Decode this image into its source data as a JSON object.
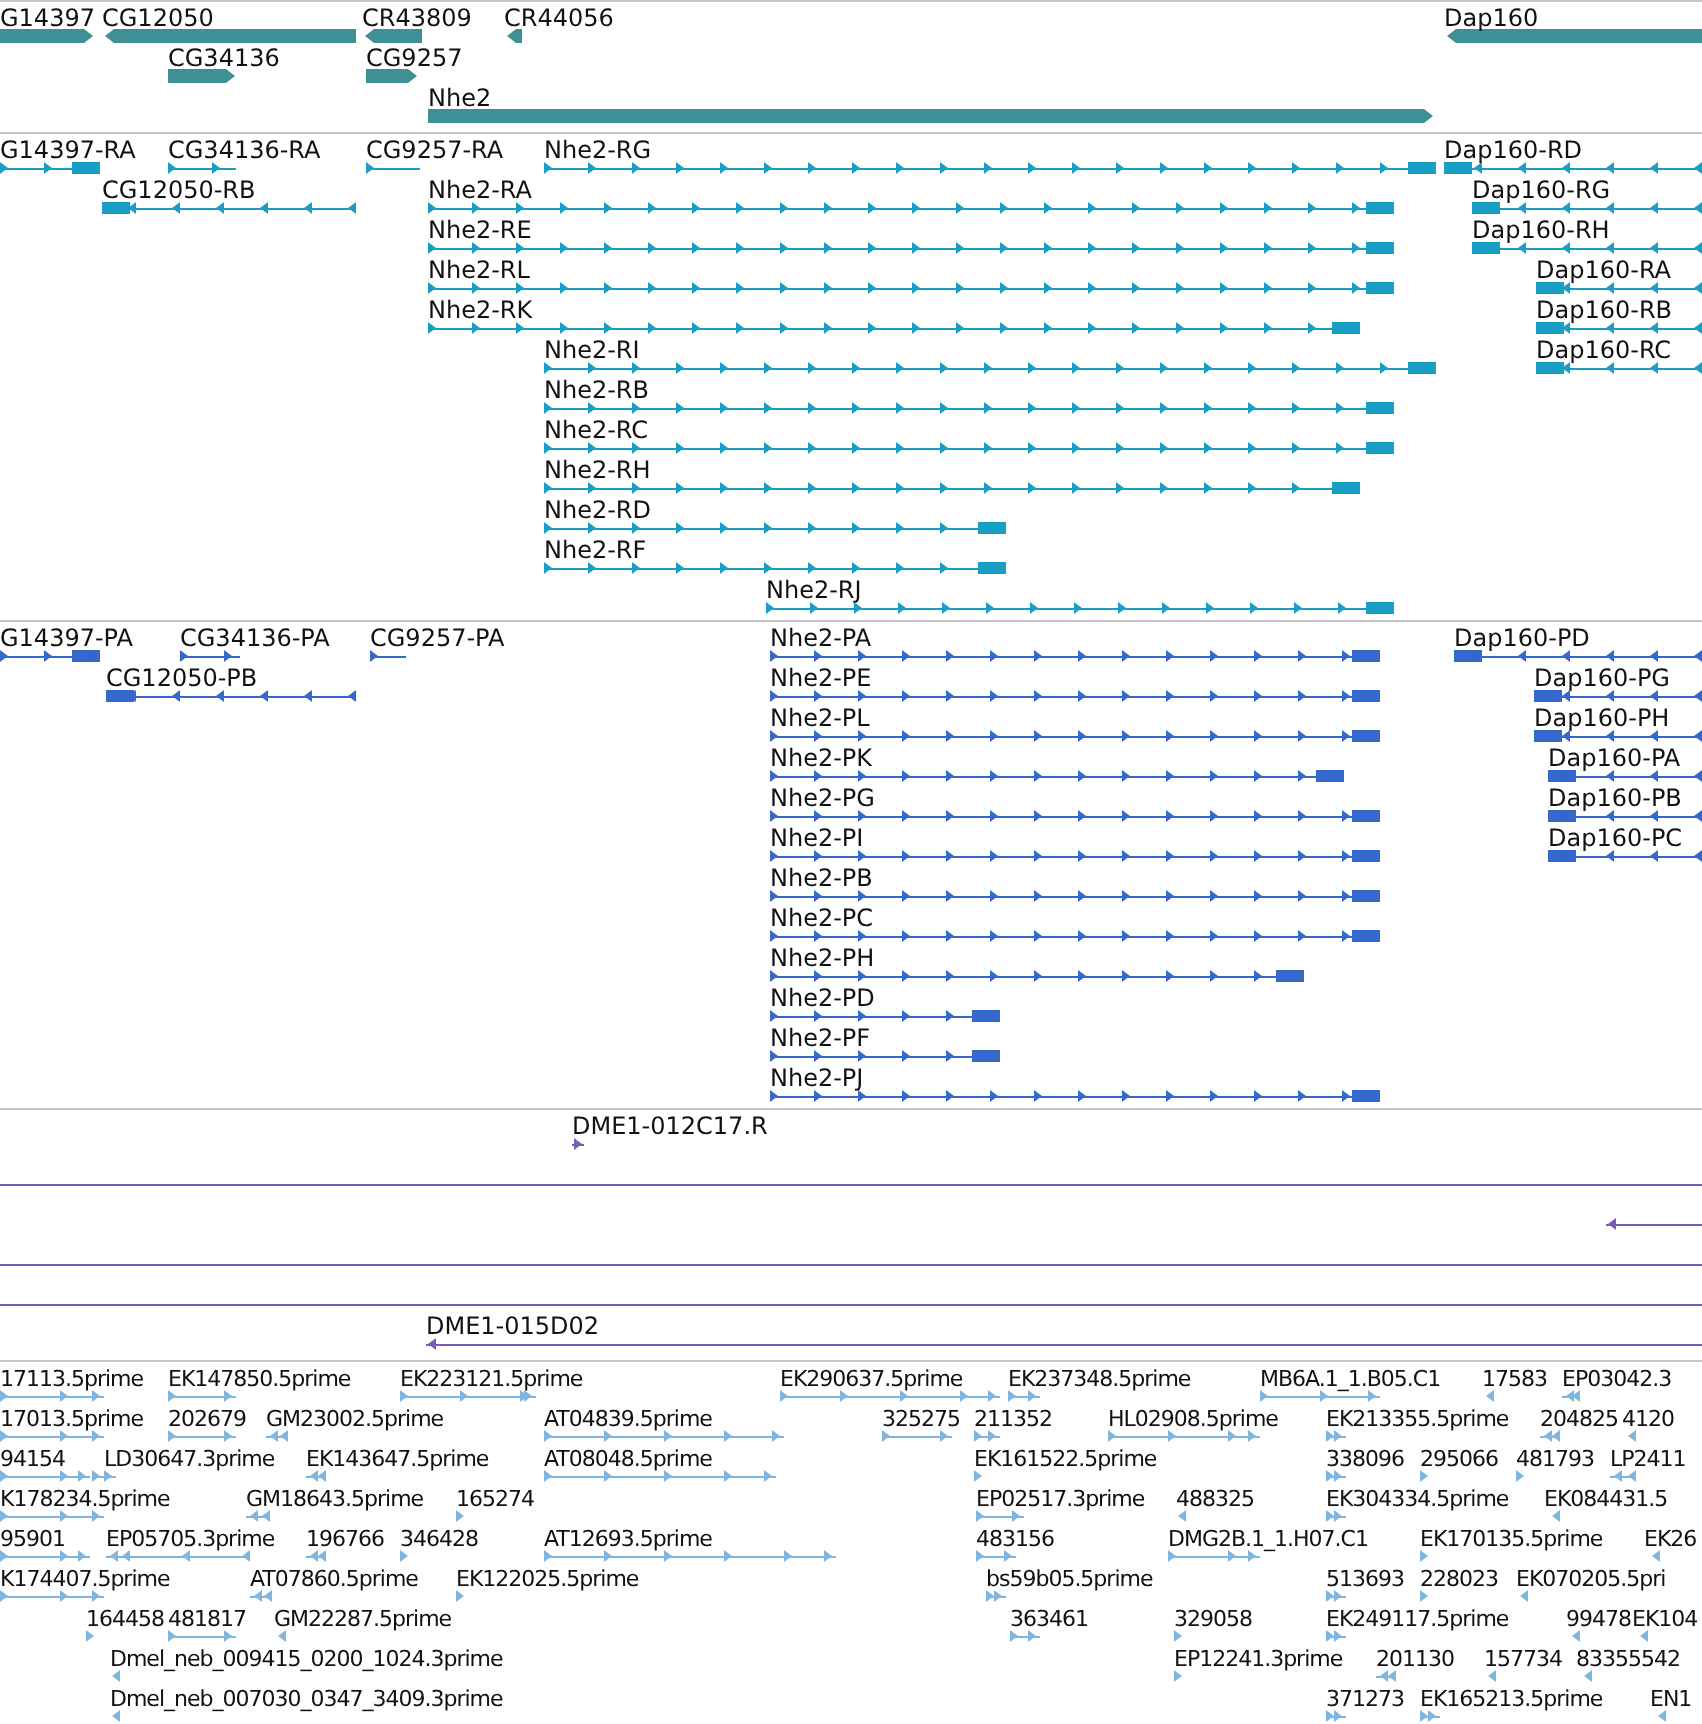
{
  "tracks": [
    {
      "kind": "gene",
      "features": [
        {
          "label": "G14397",
          "reverse": false
        },
        {
          "label": "CG12050",
          "reverse": true
        },
        {
          "label": "CR43809",
          "reverse": true
        },
        {
          "label": "CR44056",
          "reverse": true
        },
        {
          "label": "Dap160",
          "reverse": true
        },
        {
          "label": "CG34136",
          "reverse": false
        },
        {
          "label": "CG9257",
          "reverse": false
        },
        {
          "label": "Nhe2",
          "reverse": false
        }
      ]
    },
    {
      "kind": "transcript",
      "features": [
        {
          "label": "G14397-RA",
          "reverse": false
        },
        {
          "label": "CG34136-RA",
          "reverse": false
        },
        {
          "label": "CG9257-RA",
          "reverse": false
        },
        {
          "label": "Nhe2-RG",
          "reverse": false
        },
        {
          "label": "Dap160-RD",
          "reverse": true
        },
        {
          "label": "CG12050-RB",
          "reverse": true
        },
        {
          "label": "Nhe2-RA",
          "reverse": false
        },
        {
          "label": "Dap160-RG",
          "reverse": true
        },
        {
          "label": "Nhe2-RE",
          "reverse": false
        },
        {
          "label": "Dap160-RH",
          "reverse": true
        },
        {
          "label": "Nhe2-RL",
          "reverse": false
        },
        {
          "label": "Dap160-RA",
          "reverse": true
        },
        {
          "label": "Nhe2-RK",
          "reverse": false
        },
        {
          "label": "Dap160-RB",
          "reverse": true
        },
        {
          "label": "Nhe2-RI",
          "reverse": false
        },
        {
          "label": "Dap160-RC",
          "reverse": true
        },
        {
          "label": "Nhe2-RB",
          "reverse": false
        },
        {
          "label": "Nhe2-RC",
          "reverse": false
        },
        {
          "label": "Nhe2-RH",
          "reverse": false
        },
        {
          "label": "Nhe2-RD",
          "reverse": false
        },
        {
          "label": "Nhe2-RF",
          "reverse": false
        },
        {
          "label": "Nhe2-RJ",
          "reverse": false
        }
      ]
    },
    {
      "kind": "protein",
      "features": [
        {
          "label": "G14397-PA",
          "reverse": false
        },
        {
          "label": "CG34136-PA",
          "reverse": false
        },
        {
          "label": "CG9257-PA",
          "reverse": false
        },
        {
          "label": "Nhe2-PA",
          "reverse": false
        },
        {
          "label": "Dap160-PD",
          "reverse": true
        },
        {
          "label": "CG12050-PB",
          "reverse": true
        },
        {
          "label": "Nhe2-PE",
          "reverse": false
        },
        {
          "label": "Dap160-PG",
          "reverse": true
        },
        {
          "label": "Nhe2-PL",
          "reverse": false
        },
        {
          "label": "Dap160-PH",
          "reverse": true
        },
        {
          "label": "Nhe2-PK",
          "reverse": false
        },
        {
          "label": "Dap160-PA",
          "reverse": true
        },
        {
          "label": "Nhe2-PG",
          "reverse": false
        },
        {
          "label": "Dap160-PB",
          "reverse": true
        },
        {
          "label": "Nhe2-PI",
          "reverse": false
        },
        {
          "label": "Dap160-PC",
          "reverse": true
        },
        {
          "label": "Nhe2-PB",
          "reverse": false
        },
        {
          "label": "Nhe2-PC",
          "reverse": false
        },
        {
          "label": "Nhe2-PH",
          "reverse": false
        },
        {
          "label": "Nhe2-PD",
          "reverse": false
        },
        {
          "label": "Nhe2-PF",
          "reverse": false
        },
        {
          "label": "Nhe2-PJ",
          "reverse": false
        }
      ]
    },
    {
      "kind": "clone",
      "features": [
        {
          "kind": "clone",
          "label": "DME1-012C17.R",
          "reverse": false
        },
        {
          "kind": "span"
        },
        {
          "kind": "span",
          "reverse": true
        },
        {
          "kind": "span"
        },
        {
          "kind": "span"
        },
        {
          "kind": "clone",
          "label": "DME1-015D02",
          "reverse": true
        }
      ]
    },
    {
      "kind": "est",
      "features": [
        {
          "label": "17113.5prime",
          "reverse": false
        },
        {
          "label": "EK147850.5prime",
          "reverse": false
        },
        {
          "label": "EK223121.5prime",
          "reverse": false
        },
        {
          "label": "EK290637.5prime",
          "reverse": false
        },
        {
          "label": "EK237348.5prime",
          "reverse": false
        },
        {
          "label": "MB6A.1_1.B05.C1",
          "reverse": false
        },
        {
          "label": "17583",
          "reverse": true
        },
        {
          "label": "EP03042.3",
          "reverse": true
        },
        {
          "label": "17013.5prime",
          "reverse": false
        },
        {
          "label": "202679",
          "reverse": false
        },
        {
          "label": "GM23002.5prime",
          "reverse": true
        },
        {
          "label": "AT04839.5prime",
          "reverse": false
        },
        {
          "label": "325275",
          "reverse": false
        },
        {
          "label": "211352",
          "reverse": false
        },
        {
          "label": "HL02908.5prime",
          "reverse": false
        },
        {
          "label": "EK213355.5prime",
          "reverse": false
        },
        {
          "label": "204825",
          "reverse": true
        },
        {
          "label": "4120",
          "reverse": true
        },
        {
          "label": "94154",
          "reverse": false
        },
        {
          "label": "LD30647.3prime",
          "reverse": false
        },
        {
          "label": "EK143647.5prime",
          "reverse": true
        },
        {
          "label": "AT08048.5prime",
          "reverse": false
        },
        {
          "label": "EK161522.5prime",
          "reverse": false
        },
        {
          "label": "338096",
          "reverse": false
        },
        {
          "label": "295066",
          "reverse": false
        },
        {
          "label": "481793",
          "reverse": false
        },
        {
          "label": "LP2411",
          "reverse": true
        },
        {
          "label": "K178234.5prime",
          "reverse": false
        },
        {
          "label": "GM18643.5prime",
          "reverse": true
        },
        {
          "label": "165274",
          "reverse": false
        },
        {
          "label": "EP02517.3prime",
          "reverse": false
        },
        {
          "label": "488325",
          "reverse": true
        },
        {
          "label": "EK304334.5prime",
          "reverse": false
        },
        {
          "label": "EK084431.5",
          "reverse": true
        },
        {
          "label": "95901",
          "reverse": false
        },
        {
          "label": "EP05705.3prime",
          "reverse": true
        },
        {
          "label": "196766",
          "reverse": true
        },
        {
          "label": "346428",
          "reverse": false
        },
        {
          "label": "AT12693.5prime",
          "reverse": false
        },
        {
          "label": "483156",
          "reverse": false
        },
        {
          "label": "DMG2B.1_1.H07.C1",
          "reverse": false
        },
        {
          "label": "EK170135.5prime",
          "reverse": false
        },
        {
          "label": "EK26",
          "reverse": true
        },
        {
          "label": "K174407.5prime",
          "reverse": false
        },
        {
          "label": "AT07860.5prime",
          "reverse": true
        },
        {
          "label": "EK122025.5prime",
          "reverse": false
        },
        {
          "label": "bs59b05.5prime",
          "reverse": false
        },
        {
          "label": "513693",
          "reverse": false
        },
        {
          "label": "228023",
          "reverse": false
        },
        {
          "label": "EK070205.5pri",
          "reverse": true
        },
        {
          "label": "164458",
          "reverse": false
        },
        {
          "label": "481817",
          "reverse": false
        },
        {
          "label": "GM22287.5prime",
          "reverse": true
        },
        {
          "label": "363461",
          "reverse": false
        },
        {
          "label": "329058",
          "reverse": false
        },
        {
          "label": "EK249117.5prime",
          "reverse": false
        },
        {
          "label": "99478",
          "reverse": true
        },
        {
          "label": "EK104",
          "reverse": true
        },
        {
          "label": "Dmel_neb_009415_0200_1024.3prime",
          "reverse": true
        },
        {
          "label": "EP12241.3prime",
          "reverse": false
        },
        {
          "label": "201130",
          "reverse": true
        },
        {
          "label": "157734",
          "reverse": true
        },
        {
          "label": "83355542",
          "reverse": true
        },
        {
          "label": "Dmel_neb_007030_0347_3409.3prime",
          "reverse": true
        },
        {
          "label": "371273",
          "reverse": false
        },
        {
          "label": "EK165213.5prime",
          "reverse": false
        },
        {
          "label": "EN1",
          "reverse": true
        }
      ]
    }
  ]
}
